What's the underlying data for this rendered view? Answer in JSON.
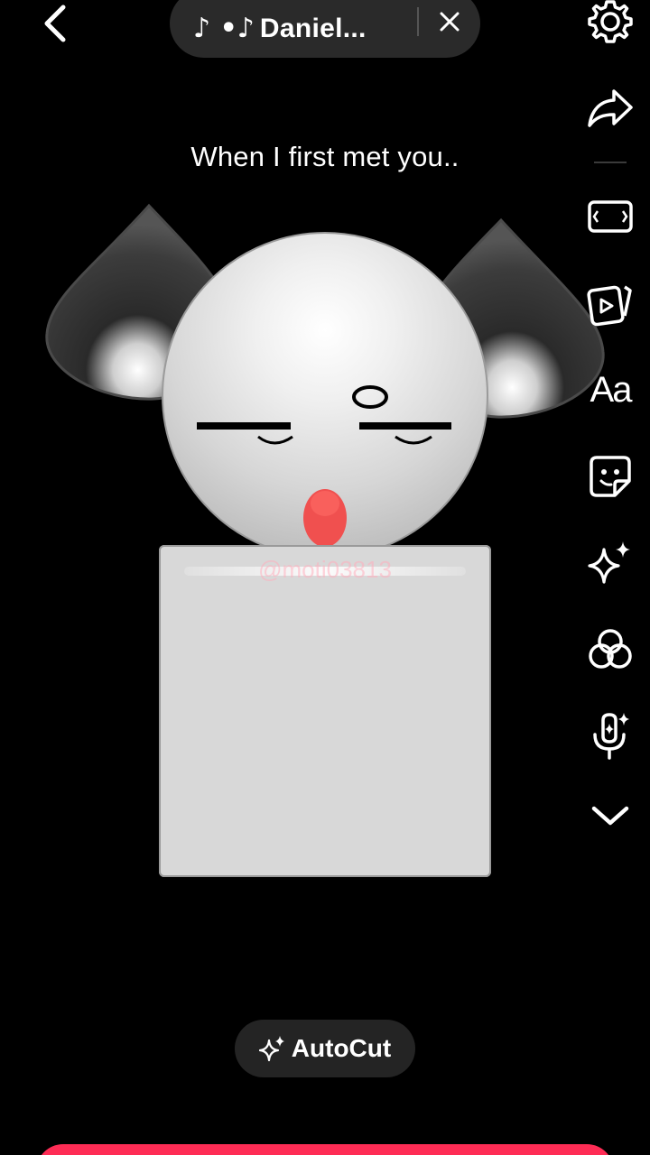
{
  "topbar": {
    "sound_notes": "♪ •♪",
    "sound_title": "Daniel...",
    "back_icon": "chevron-left-icon",
    "close_icon": "close-icon"
  },
  "caption": "When I first met you..",
  "watermark": "@moti03813",
  "toolbar": {
    "items": [
      {
        "name": "settings",
        "icon": "gear-icon"
      },
      {
        "name": "share",
        "icon": "share-arrow-icon"
      },
      {
        "name": "aspect-ratio",
        "icon": "rectangle-frame-icon"
      },
      {
        "name": "templates",
        "icon": "play-cards-icon"
      },
      {
        "name": "text",
        "icon": "text-aa-icon",
        "label": "Aa"
      },
      {
        "name": "stickers",
        "icon": "sticker-icon"
      },
      {
        "name": "effects",
        "icon": "sparkle-icon"
      },
      {
        "name": "filters",
        "icon": "filter-circles-icon"
      },
      {
        "name": "voice",
        "icon": "microphone-sparkle-icon"
      },
      {
        "name": "more",
        "icon": "chevron-down-icon"
      }
    ]
  },
  "bottom": {
    "autocut_label": "AutoCut",
    "autocut_icon": "sparkle-icon"
  },
  "colors": {
    "background": "#000000",
    "accent": "#fe2c55",
    "pill": "#2a2a2a",
    "mouth": "#f0504f",
    "character": "#d8d8d8"
  }
}
